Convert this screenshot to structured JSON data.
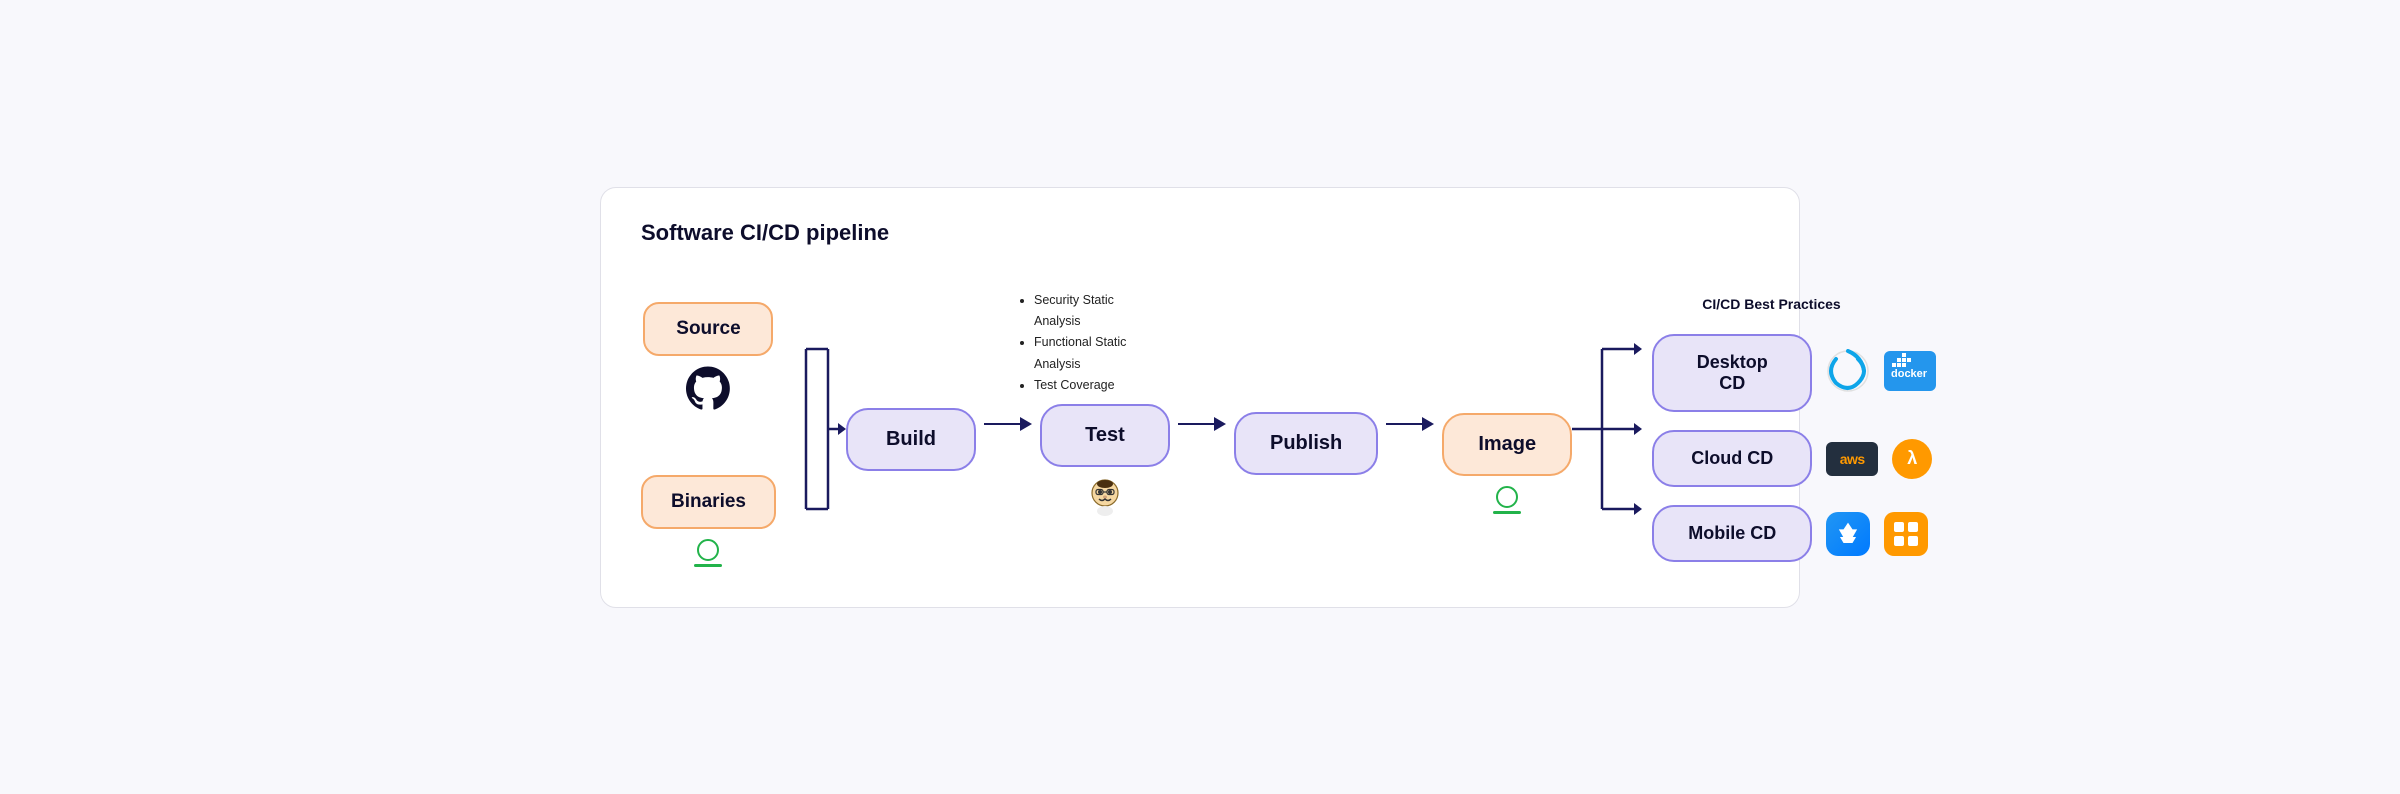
{
  "title": "Software CI/CD pipeline",
  "best_practices_title": "CI/CD Best Practices",
  "source_box": "Source",
  "binaries_box": "Binaries",
  "build_box": "Build",
  "test_box": "Test",
  "publish_box": "Publish",
  "image_box": "Image",
  "desktop_cd_box": "Desktop CD",
  "cloud_cd_box": "Cloud CD",
  "mobile_cd_box": "Mobile CD",
  "notes": [
    "Security Static Analysis",
    "Functional Static Analysis",
    "Test Coverage"
  ],
  "logos": {
    "ci_tool": "CI",
    "docker": "Docker",
    "aws": "aws",
    "lambda": "λ",
    "appstore": "A",
    "grid": "grid"
  },
  "colors": {
    "orange_bg": "#fde8d8",
    "orange_border": "#f5a96a",
    "purple_bg": "#e8e4f8",
    "purple_border": "#8b7fe8",
    "arrow": "#1a1a5e",
    "title": "#0d0d2b",
    "green": "#22b34a"
  }
}
